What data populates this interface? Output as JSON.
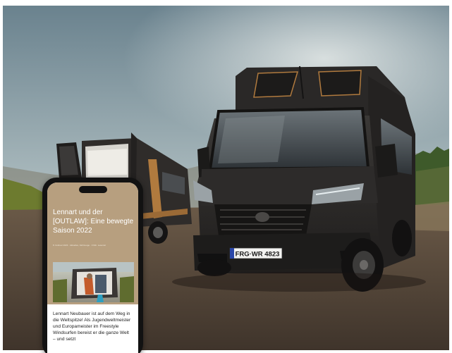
{
  "phone": {
    "headline": "Lennart und der [OUTLAW]: Eine bewegte Saison 2022",
    "meta": "8. Februar 2023 · Aktuelles, Fahrzeuge · 3 Min. Lesezeit",
    "body": "Lennart Neubauer ist auf dem Weg in die Weltspitze! Als Jugendweltmeister und Europameister im Freestyle Windsurfen bereist er die ganze Welt – und setzt"
  },
  "van": {
    "plate": "FRG·WR 4823"
  },
  "colors": {
    "sky_top": "#6f8793",
    "sky_bottom": "#cdd6d5",
    "ground": "#56483c",
    "van_body": "#2a2827",
    "van_accent": "#b07a3e",
    "phone_header": "#b79f7f"
  }
}
